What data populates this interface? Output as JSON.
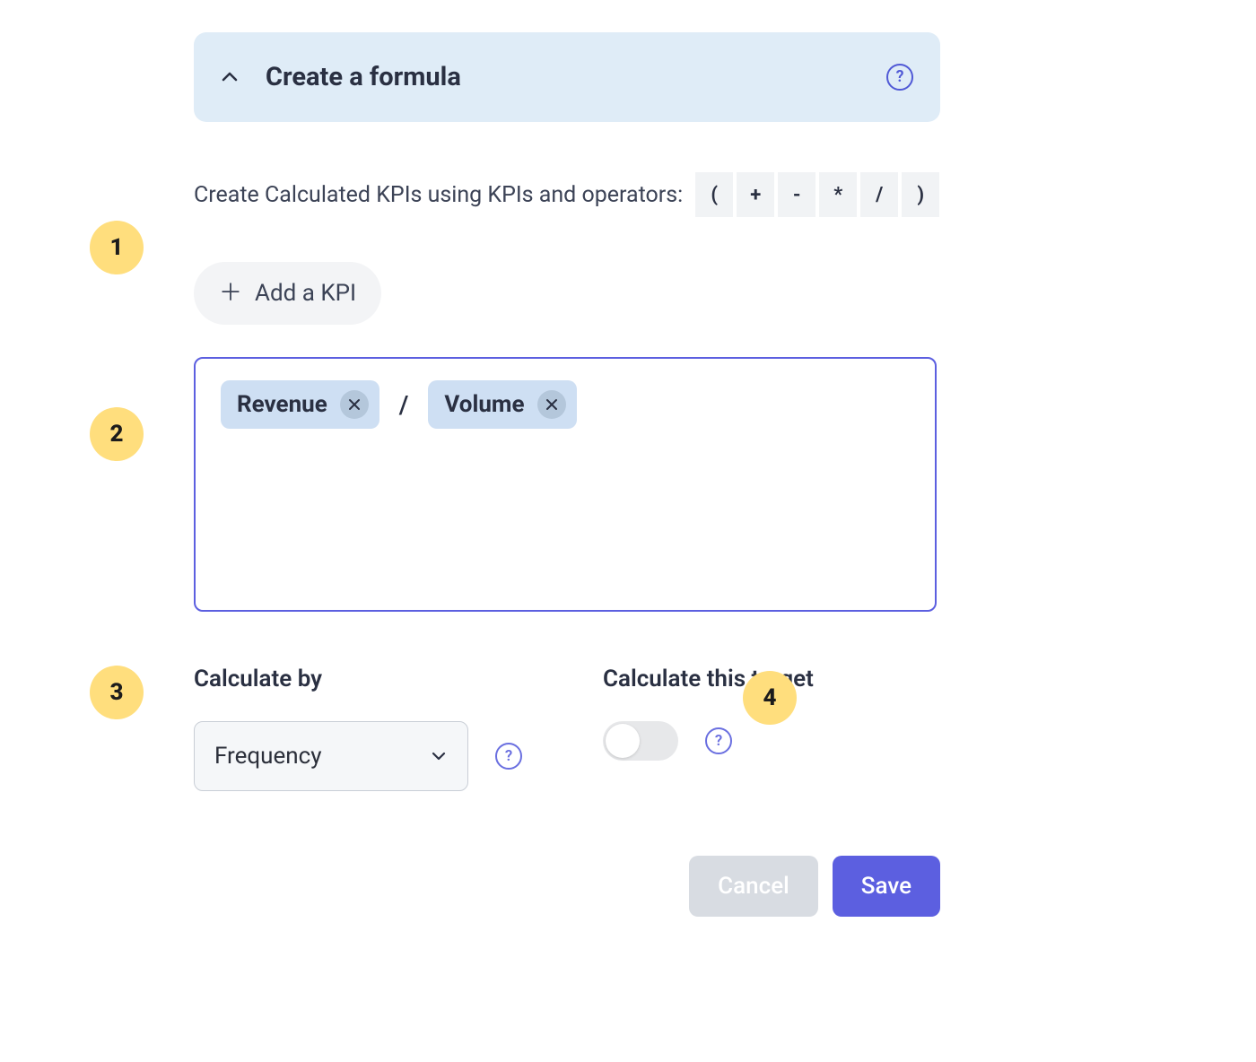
{
  "header": {
    "title": "Create a formula"
  },
  "description": "Create Calculated KPIs using KPIs and operators:",
  "operators": [
    "(",
    "+",
    "-",
    "*",
    "/",
    ")"
  ],
  "addKpi": {
    "label": "Add a KPI"
  },
  "formula": {
    "chips": [
      {
        "label": "Revenue"
      },
      {
        "label": "Volume"
      }
    ],
    "operator": "/"
  },
  "calculateBy": {
    "label": "Calculate by",
    "selectValue": "Frequency"
  },
  "calculateTarget": {
    "label": "Calculate this target"
  },
  "footer": {
    "cancel": "Cancel",
    "save": "Save"
  },
  "markers": {
    "m1": "1",
    "m2": "2",
    "m3": "3",
    "m4": "4"
  }
}
